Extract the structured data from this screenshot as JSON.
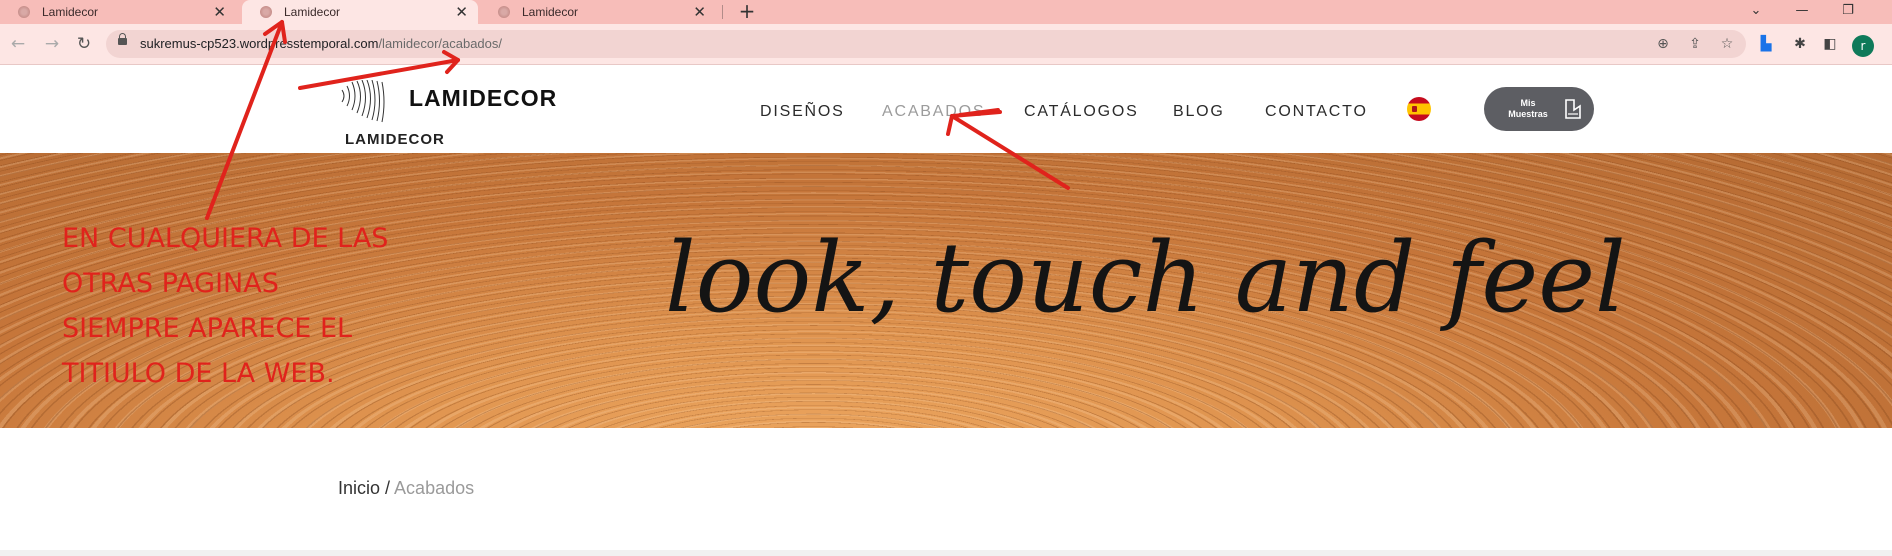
{
  "browser": {
    "tabs": [
      {
        "title": "Lamidecor",
        "active": false
      },
      {
        "title": "Lamidecor",
        "active": true
      },
      {
        "title": "Lamidecor",
        "active": false
      }
    ],
    "url_host": "sukremus-cp523.wordpresstemporal.com",
    "url_path": "/lamidecor/acabados/",
    "profile_initial": "r"
  },
  "site": {
    "brand": "LAMIDECOR",
    "brand_sub": "LAMIDECOR",
    "menu": [
      "DISEÑOS",
      "ACABADOS",
      "CATÁLOGOS",
      "BLOG",
      "CONTACTO"
    ],
    "active_menu": "ACABADOS",
    "samples_button": {
      "line1": "Mis",
      "line2": "Muestras"
    },
    "hero_text": "look, touch and feel",
    "breadcrumb": {
      "home": "Inicio",
      "separator": " / ",
      "current": "Acabados"
    }
  },
  "annotation": {
    "lines": [
      "EN CUALQUIERA DE LAS",
      "OTRAS PAGINAS",
      "SIEMPRE APARECE EL",
      "TITIULO DE LA WEB."
    ],
    "color": "#e0231c"
  },
  "colors": {
    "tabstrip": "#f7bdb9",
    "samples_button": "#5d5e63",
    "active_menu": "#9c9c9c"
  }
}
